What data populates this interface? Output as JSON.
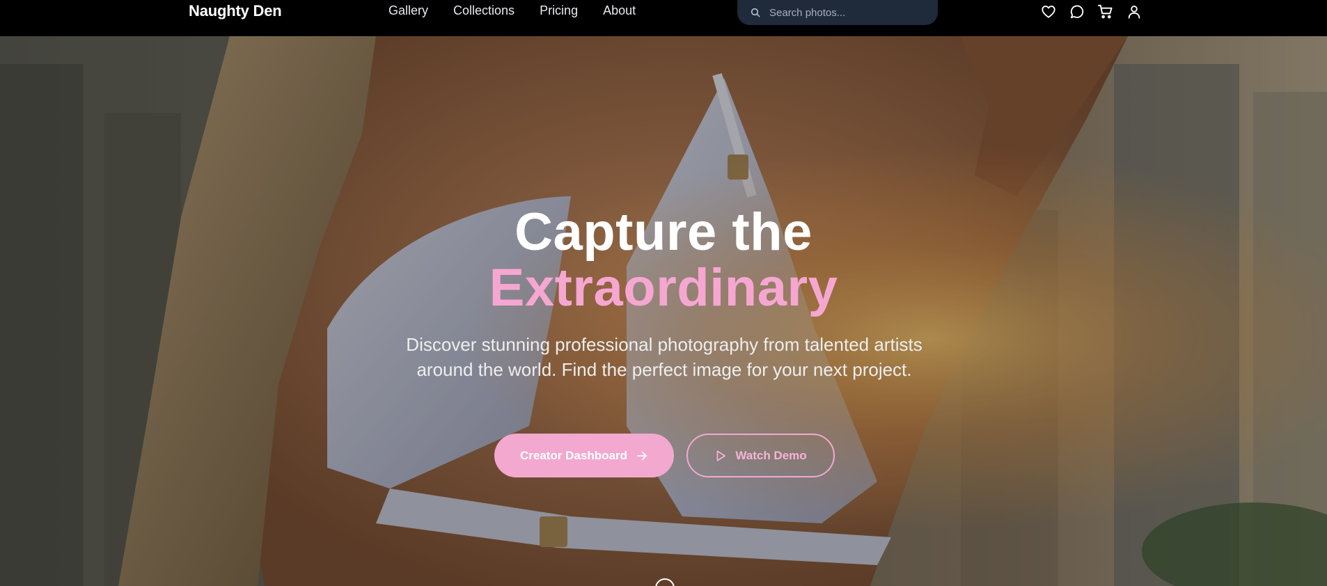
{
  "brand": {
    "name": "Naughty Den"
  },
  "nav": {
    "links": [
      "Gallery",
      "Collections",
      "Pricing",
      "About"
    ]
  },
  "search": {
    "placeholder": "Search photos...",
    "icon": "search-icon"
  },
  "header_icons": [
    "heart-icon",
    "chat-icon",
    "cart-icon",
    "user-icon"
  ],
  "hero": {
    "headline_line1": "Capture the",
    "headline_line2": "Extraordinary",
    "subtitle": "Discover stunning professional photography from talented artists around the world. Find the perfect image for your next project.",
    "primary_button": "Creator Dashboard",
    "secondary_button": "Watch Demo"
  },
  "colors": {
    "accent_pink": "#f3a8d0",
    "navbar_bg": "#000000",
    "search_bg": "#1f2a3b"
  }
}
